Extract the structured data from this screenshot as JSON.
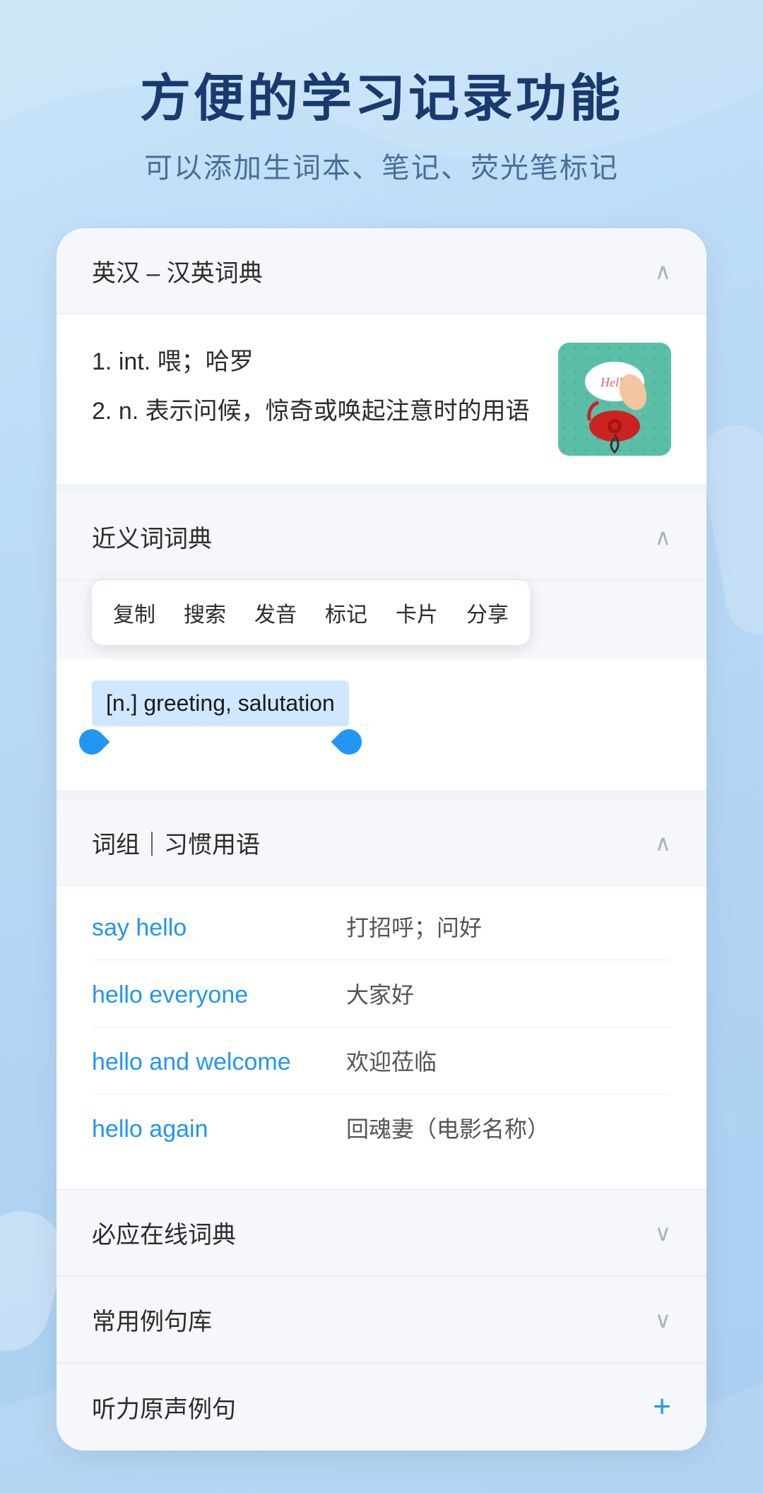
{
  "header": {
    "main_title": "方便的学习记录功能",
    "sub_title": "可以添加生词本、笔记、荧光笔标记"
  },
  "sections": {
    "english_chinese": {
      "title": "英汉 – 汉英词典",
      "definitions": [
        {
          "index": "1.",
          "type": "int.",
          "text": "喂；哈罗"
        },
        {
          "index": "2.",
          "type": "n.",
          "text": "表示问候，惊奇或唤起注意时的用语"
        }
      ]
    },
    "synonym": {
      "title": "近义词词典",
      "context_menu": [
        "复制",
        "搜索",
        "发音",
        "标记",
        "卡片",
        "分享"
      ],
      "synonym_text": "[n.] greeting, salutation"
    },
    "phrases": {
      "title": "词组｜习惯用语",
      "items": [
        {
          "english": "say hello",
          "chinese": "打招呼；问好"
        },
        {
          "english": "hello everyone",
          "chinese": "大家好"
        },
        {
          "english": "hello and welcome",
          "chinese": "欢迎莅临"
        },
        {
          "english": "hello again",
          "chinese": "回魂妻（电影名称）"
        }
      ]
    },
    "online_dict": {
      "title": "必应在线词典"
    },
    "example_sentences": {
      "title": "常用例句库"
    },
    "audio_sentences": {
      "title": "听力原声例句"
    }
  },
  "icons": {
    "chevron_up": "∧",
    "chevron_down": "∨",
    "plus": "+"
  }
}
